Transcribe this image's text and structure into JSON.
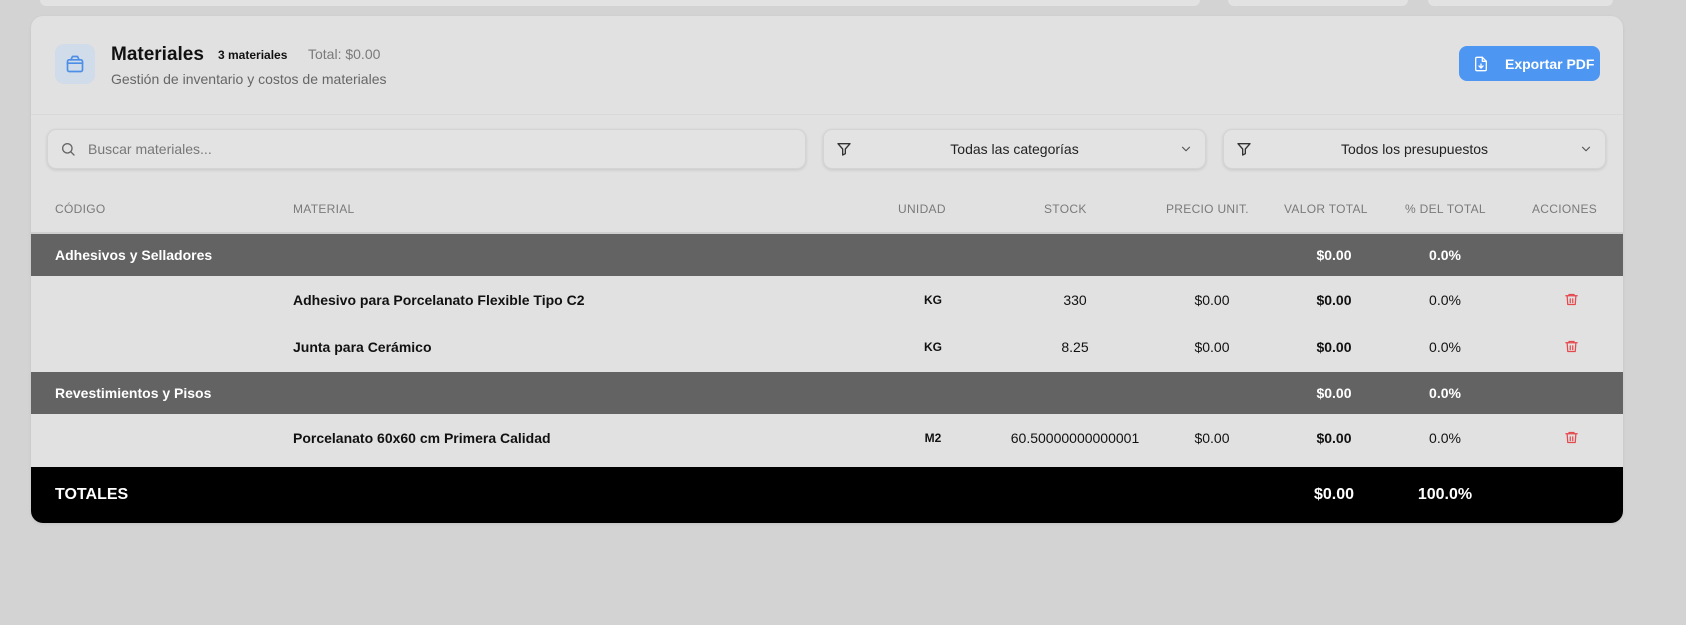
{
  "header": {
    "icon": "package-icon",
    "title": "Materiales",
    "count_badge": "3 materiales",
    "total": "Total: $0.00",
    "subtitle": "Gestión de inventario y costos de materiales",
    "export_label": "Exportar PDF"
  },
  "filters": {
    "search_placeholder": "Buscar materiales...",
    "category_value": "Todas las categorías",
    "budget_value": "Todos los presupuestos"
  },
  "columns": [
    "CÓDIGO",
    "MATERIAL",
    "UNIDAD",
    "STOCK",
    "PRECIO UNIT.",
    "VALOR TOTAL",
    "% DEL TOTAL",
    "ACCIONES"
  ],
  "groups": [
    {
      "name": "Adhesivos y Selladores",
      "value_total": "$0.00",
      "percent": "0.0%",
      "items": [
        {
          "code": "",
          "material": "Adhesivo para Porcelanato Flexible Tipo C2",
          "unit": "KG",
          "stock": "330",
          "price": "$0.00",
          "value": "$0.00",
          "percent": "0.0%"
        },
        {
          "code": "",
          "material": "Junta para Cerámico",
          "unit": "KG",
          "stock": "8.25",
          "price": "$0.00",
          "value": "$0.00",
          "percent": "0.0%"
        }
      ]
    },
    {
      "name": "Revestimientos y Pisos",
      "value_total": "$0.00",
      "percent": "0.0%",
      "items": [
        {
          "code": "",
          "material": "Porcelanato 60x60 cm Primera Calidad",
          "unit": "M2",
          "stock": "60.50000000000001",
          "price": "$0.00",
          "value": "$0.00",
          "percent": "0.0%"
        }
      ]
    }
  ],
  "totals": {
    "label": "TOTALES",
    "value": "$0.00",
    "percent": "100.0%"
  },
  "colors": {
    "accent": "#4d97f3",
    "delete": "#e5484d",
    "group_row": "#636363",
    "totals_row": "#000000"
  }
}
